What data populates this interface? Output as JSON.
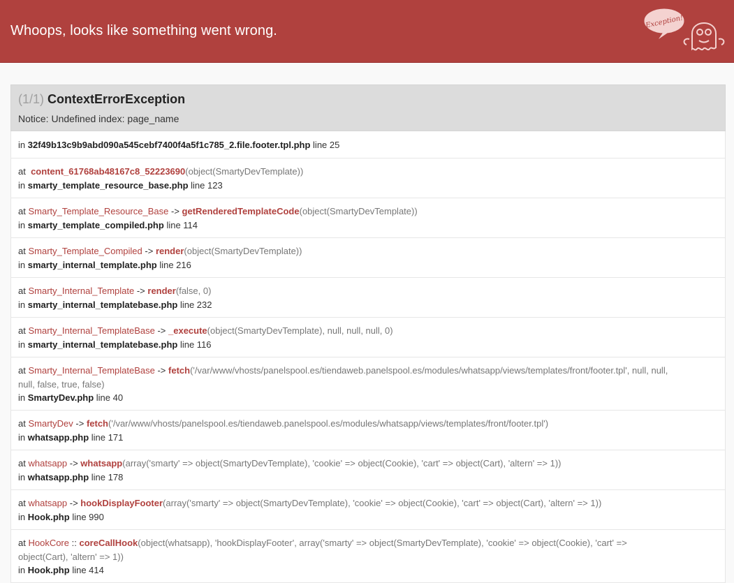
{
  "header": {
    "title": "Whoops, looks like something went wrong.",
    "illustration_text": "Exception!"
  },
  "exception": {
    "count": "(1/1)",
    "class_name": "ContextErrorException",
    "message": "Notice: Undefined index: page_name"
  },
  "trace": [
    {
      "file_prefix": "in",
      "file": "32f49b13c9b9abd090a545cebf7400f4a5f1c785_2.file.footer.tpl.php",
      "line_label": "line 25"
    },
    {
      "at": "at",
      "cls": "",
      "type": "",
      "fn": "content_61768ab48167c8_52223690",
      "args_open": "(",
      "args": "object(SmartyDevTemplate)",
      "args_close": ")",
      "file_prefix": "in",
      "file": "smarty_template_resource_base.php",
      "line_label": "line 123"
    },
    {
      "at": "at",
      "cls": "Smarty_Template_Resource_Base",
      "type": "->",
      "fn": "getRenderedTemplateCode",
      "args_open": "(",
      "args": "object(SmartyDevTemplate)",
      "args_close": ")",
      "file_prefix": "in",
      "file": "smarty_template_compiled.php",
      "line_label": "line 114"
    },
    {
      "at": "at",
      "cls": "Smarty_Template_Compiled",
      "type": "->",
      "fn": "render",
      "args_open": "(",
      "args": "object(SmartyDevTemplate)",
      "args_close": ")",
      "file_prefix": "in",
      "file": "smarty_internal_template.php",
      "line_label": "line 216"
    },
    {
      "at": "at",
      "cls": "Smarty_Internal_Template",
      "type": "->",
      "fn": "render",
      "args_open": "(",
      "args": "false, 0",
      "args_close": ")",
      "file_prefix": "in",
      "file": "smarty_internal_templatebase.php",
      "line_label": "line 232"
    },
    {
      "at": "at",
      "cls": "Smarty_Internal_TemplateBase",
      "type": "->",
      "fn": "_execute",
      "args_open": "(",
      "args": "object(SmartyDevTemplate), null, null, null, 0",
      "args_close": ")",
      "file_prefix": "in",
      "file": "smarty_internal_templatebase.php",
      "line_label": "line 116"
    },
    {
      "at": "at",
      "cls": "Smarty_Internal_TemplateBase",
      "type": "->",
      "fn": "fetch",
      "args_open": "(",
      "args": "'/var/www/vhosts/panelspool.es/tiendaweb.panelspool.es/modules/whatsapp/views/templates/front/footer.tpl', null, null,",
      "args_cont": "null, false, true, false",
      "args_close": ")",
      "file_prefix": "in",
      "file": "SmartyDev.php",
      "line_label": "line 40"
    },
    {
      "at": "at",
      "cls": "SmartyDev",
      "type": "->",
      "fn": "fetch",
      "args_open": "(",
      "args": "'/var/www/vhosts/panelspool.es/tiendaweb.panelspool.es/modules/whatsapp/views/templates/front/footer.tpl'",
      "args_close": ")",
      "file_prefix": "in",
      "file": "whatsapp.php",
      "line_label": "line 171"
    },
    {
      "at": "at",
      "cls": "whatsapp",
      "type": "->",
      "fn": "whatsapp",
      "args_open": "(",
      "args": "array('smarty' => object(SmartyDevTemplate), 'cookie' => object(Cookie), 'cart' => object(Cart), 'altern' => 1)",
      "args_close": ")",
      "file_prefix": "in",
      "file": "whatsapp.php",
      "line_label": "line 178"
    },
    {
      "at": "at",
      "cls": "whatsapp",
      "type": "->",
      "fn": "hookDisplayFooter",
      "args_open": "(",
      "args": "array('smarty' => object(SmartyDevTemplate), 'cookie' => object(Cookie), 'cart' => object(Cart), 'altern' => 1)",
      "args_close": ")",
      "file_prefix": "in",
      "file": "Hook.php",
      "line_label": "line 990"
    },
    {
      "at": "at",
      "cls": "HookCore",
      "type": "::",
      "fn": "coreCallHook",
      "args_open": "(",
      "args": "object(whatsapp), 'hookDisplayFooter', array('smarty' => object(SmartyDevTemplate), 'cookie' => object(Cookie), 'cart' =>",
      "args_cont": "object(Cart), 'altern' => 1)",
      "args_close": ")",
      "file_prefix": "in",
      "file": "Hook.php",
      "line_label": "line 414"
    }
  ],
  "colors": {
    "header_bg": "#b0413e",
    "accent": "#b0413e",
    "exception_header_bg": "#dcdcdc"
  },
  "icons": {
    "illustration": "ghost-exception-icon"
  }
}
